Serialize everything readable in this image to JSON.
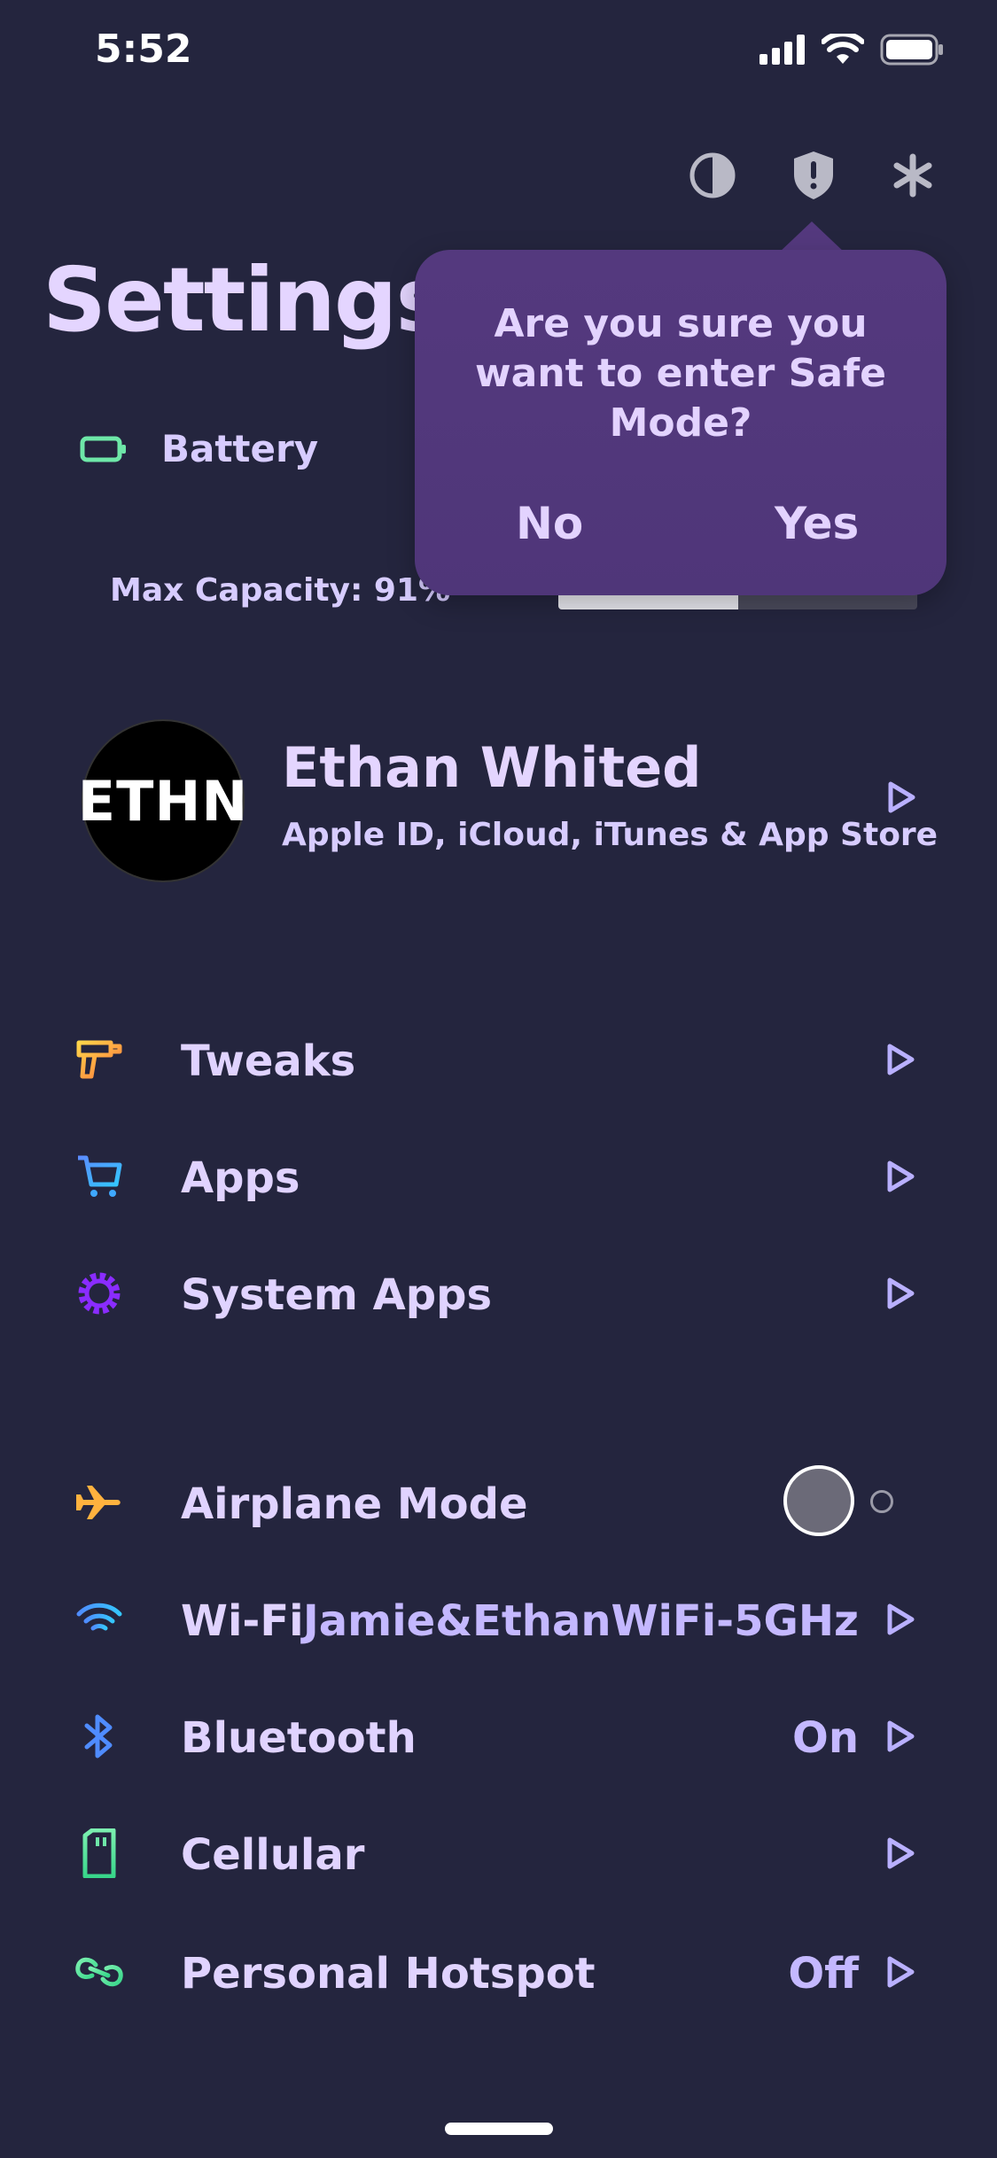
{
  "status_bar": {
    "time": "5:52"
  },
  "header": {
    "title": "Settings"
  },
  "battery": {
    "label": "Battery",
    "capacity_text": "Max Capacity: 91%",
    "capacity_fraction": 0.5
  },
  "safe_mode_popover": {
    "question": "Are you sure you want to enter Safe Mode?",
    "no_label": "No",
    "yes_label": "Yes"
  },
  "profile": {
    "avatar_text": "ETHN",
    "name": "Ethan Whited",
    "subtitle": "Apple ID, iCloud, iTunes & App Store"
  },
  "group1": [
    {
      "label": "Tweaks",
      "icon": "drill-icon"
    },
    {
      "label": "Apps",
      "icon": "cart-icon"
    },
    {
      "label": "System Apps",
      "icon": "gear-icon"
    }
  ],
  "group2": [
    {
      "label": "Airplane Mode",
      "icon": "airplane-icon",
      "toggle": "off"
    },
    {
      "label": "Wi-Fi",
      "icon": "wifi-icon",
      "value": "Jamie&EthanWiFi-5GHz"
    },
    {
      "label": "Bluetooth",
      "icon": "bluetooth-icon",
      "value": "On"
    },
    {
      "label": "Cellular",
      "icon": "sim-card-icon"
    },
    {
      "label": "Personal Hotspot",
      "icon": "hotspot-icon",
      "value": "Off"
    }
  ],
  "colors": {
    "background": "#24253e",
    "popover": "#54397e",
    "accent_text": "#e4d5ff",
    "chevron": "#b9b0ff"
  }
}
